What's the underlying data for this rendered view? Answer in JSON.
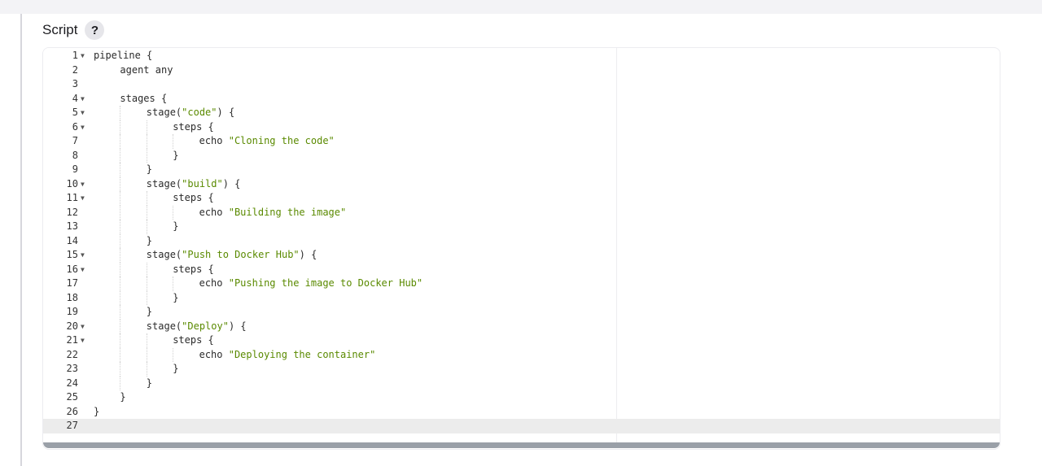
{
  "header": {
    "title": "Script",
    "help_label": "?"
  },
  "editor": {
    "active_line": 27,
    "lines": [
      {
        "n": "1",
        "fold": true,
        "indent": 0,
        "parts": [
          {
            "t": "pipeline {"
          }
        ]
      },
      {
        "n": "2",
        "fold": false,
        "indent": 1,
        "parts": [
          {
            "t": "agent any"
          }
        ]
      },
      {
        "n": "3",
        "fold": false,
        "indent": 0,
        "parts": []
      },
      {
        "n": "4",
        "fold": true,
        "indent": 1,
        "parts": [
          {
            "t": "stages {"
          }
        ]
      },
      {
        "n": "5",
        "fold": true,
        "indent": 2,
        "parts": [
          {
            "t": "stage("
          },
          {
            "t": "\"code\"",
            "s": 1
          },
          {
            "t": ") {"
          }
        ]
      },
      {
        "n": "6",
        "fold": true,
        "indent": 3,
        "parts": [
          {
            "t": "steps {"
          }
        ]
      },
      {
        "n": "7",
        "fold": false,
        "indent": 4,
        "parts": [
          {
            "t": "echo "
          },
          {
            "t": "\"Cloning the code\"",
            "s": 1
          }
        ]
      },
      {
        "n": "8",
        "fold": false,
        "indent": 3,
        "parts": [
          {
            "t": "}"
          }
        ]
      },
      {
        "n": "9",
        "fold": false,
        "indent": 2,
        "parts": [
          {
            "t": "}"
          }
        ]
      },
      {
        "n": "10",
        "fold": true,
        "indent": 2,
        "parts": [
          {
            "t": "stage("
          },
          {
            "t": "\"build\"",
            "s": 1
          },
          {
            "t": ") {"
          }
        ]
      },
      {
        "n": "11",
        "fold": true,
        "indent": 3,
        "parts": [
          {
            "t": "steps {"
          }
        ]
      },
      {
        "n": "12",
        "fold": false,
        "indent": 4,
        "parts": [
          {
            "t": "echo "
          },
          {
            "t": "\"Building the image\"",
            "s": 1
          }
        ]
      },
      {
        "n": "13",
        "fold": false,
        "indent": 3,
        "parts": [
          {
            "t": "}"
          }
        ]
      },
      {
        "n": "14",
        "fold": false,
        "indent": 2,
        "parts": [
          {
            "t": "}"
          }
        ]
      },
      {
        "n": "15",
        "fold": true,
        "indent": 2,
        "parts": [
          {
            "t": "stage("
          },
          {
            "t": "\"Push to Docker Hub\"",
            "s": 1
          },
          {
            "t": ") {"
          }
        ]
      },
      {
        "n": "16",
        "fold": true,
        "indent": 3,
        "parts": [
          {
            "t": "steps {"
          }
        ]
      },
      {
        "n": "17",
        "fold": false,
        "indent": 4,
        "parts": [
          {
            "t": "echo "
          },
          {
            "t": "\"Pushing the image to Docker Hub\"",
            "s": 1
          }
        ]
      },
      {
        "n": "18",
        "fold": false,
        "indent": 3,
        "parts": [
          {
            "t": "}"
          }
        ]
      },
      {
        "n": "19",
        "fold": false,
        "indent": 2,
        "parts": [
          {
            "t": "}"
          }
        ]
      },
      {
        "n": "20",
        "fold": true,
        "indent": 2,
        "parts": [
          {
            "t": "stage("
          },
          {
            "t": "\"Deploy\"",
            "s": 1
          },
          {
            "t": ") {"
          }
        ]
      },
      {
        "n": "21",
        "fold": true,
        "indent": 3,
        "parts": [
          {
            "t": "steps {"
          }
        ]
      },
      {
        "n": "22",
        "fold": false,
        "indent": 4,
        "parts": [
          {
            "t": "echo "
          },
          {
            "t": "\"Deploying the container\"",
            "s": 1
          }
        ]
      },
      {
        "n": "23",
        "fold": false,
        "indent": 3,
        "parts": [
          {
            "t": "}"
          }
        ]
      },
      {
        "n": "24",
        "fold": false,
        "indent": 2,
        "parts": [
          {
            "t": "}"
          }
        ]
      },
      {
        "n": "25",
        "fold": false,
        "indent": 1,
        "parts": [
          {
            "t": "}"
          }
        ]
      },
      {
        "n": "26",
        "fold": false,
        "indent": 0,
        "parts": [
          {
            "t": "}"
          }
        ]
      },
      {
        "n": "27",
        "fold": false,
        "indent": 0,
        "parts": []
      }
    ]
  },
  "icons": {
    "fold": "chevron-down-icon",
    "help": "help-icon"
  },
  "colors": {
    "string": "#5a8a00",
    "text": "#2b2b2b",
    "active_line": "#ececec"
  }
}
